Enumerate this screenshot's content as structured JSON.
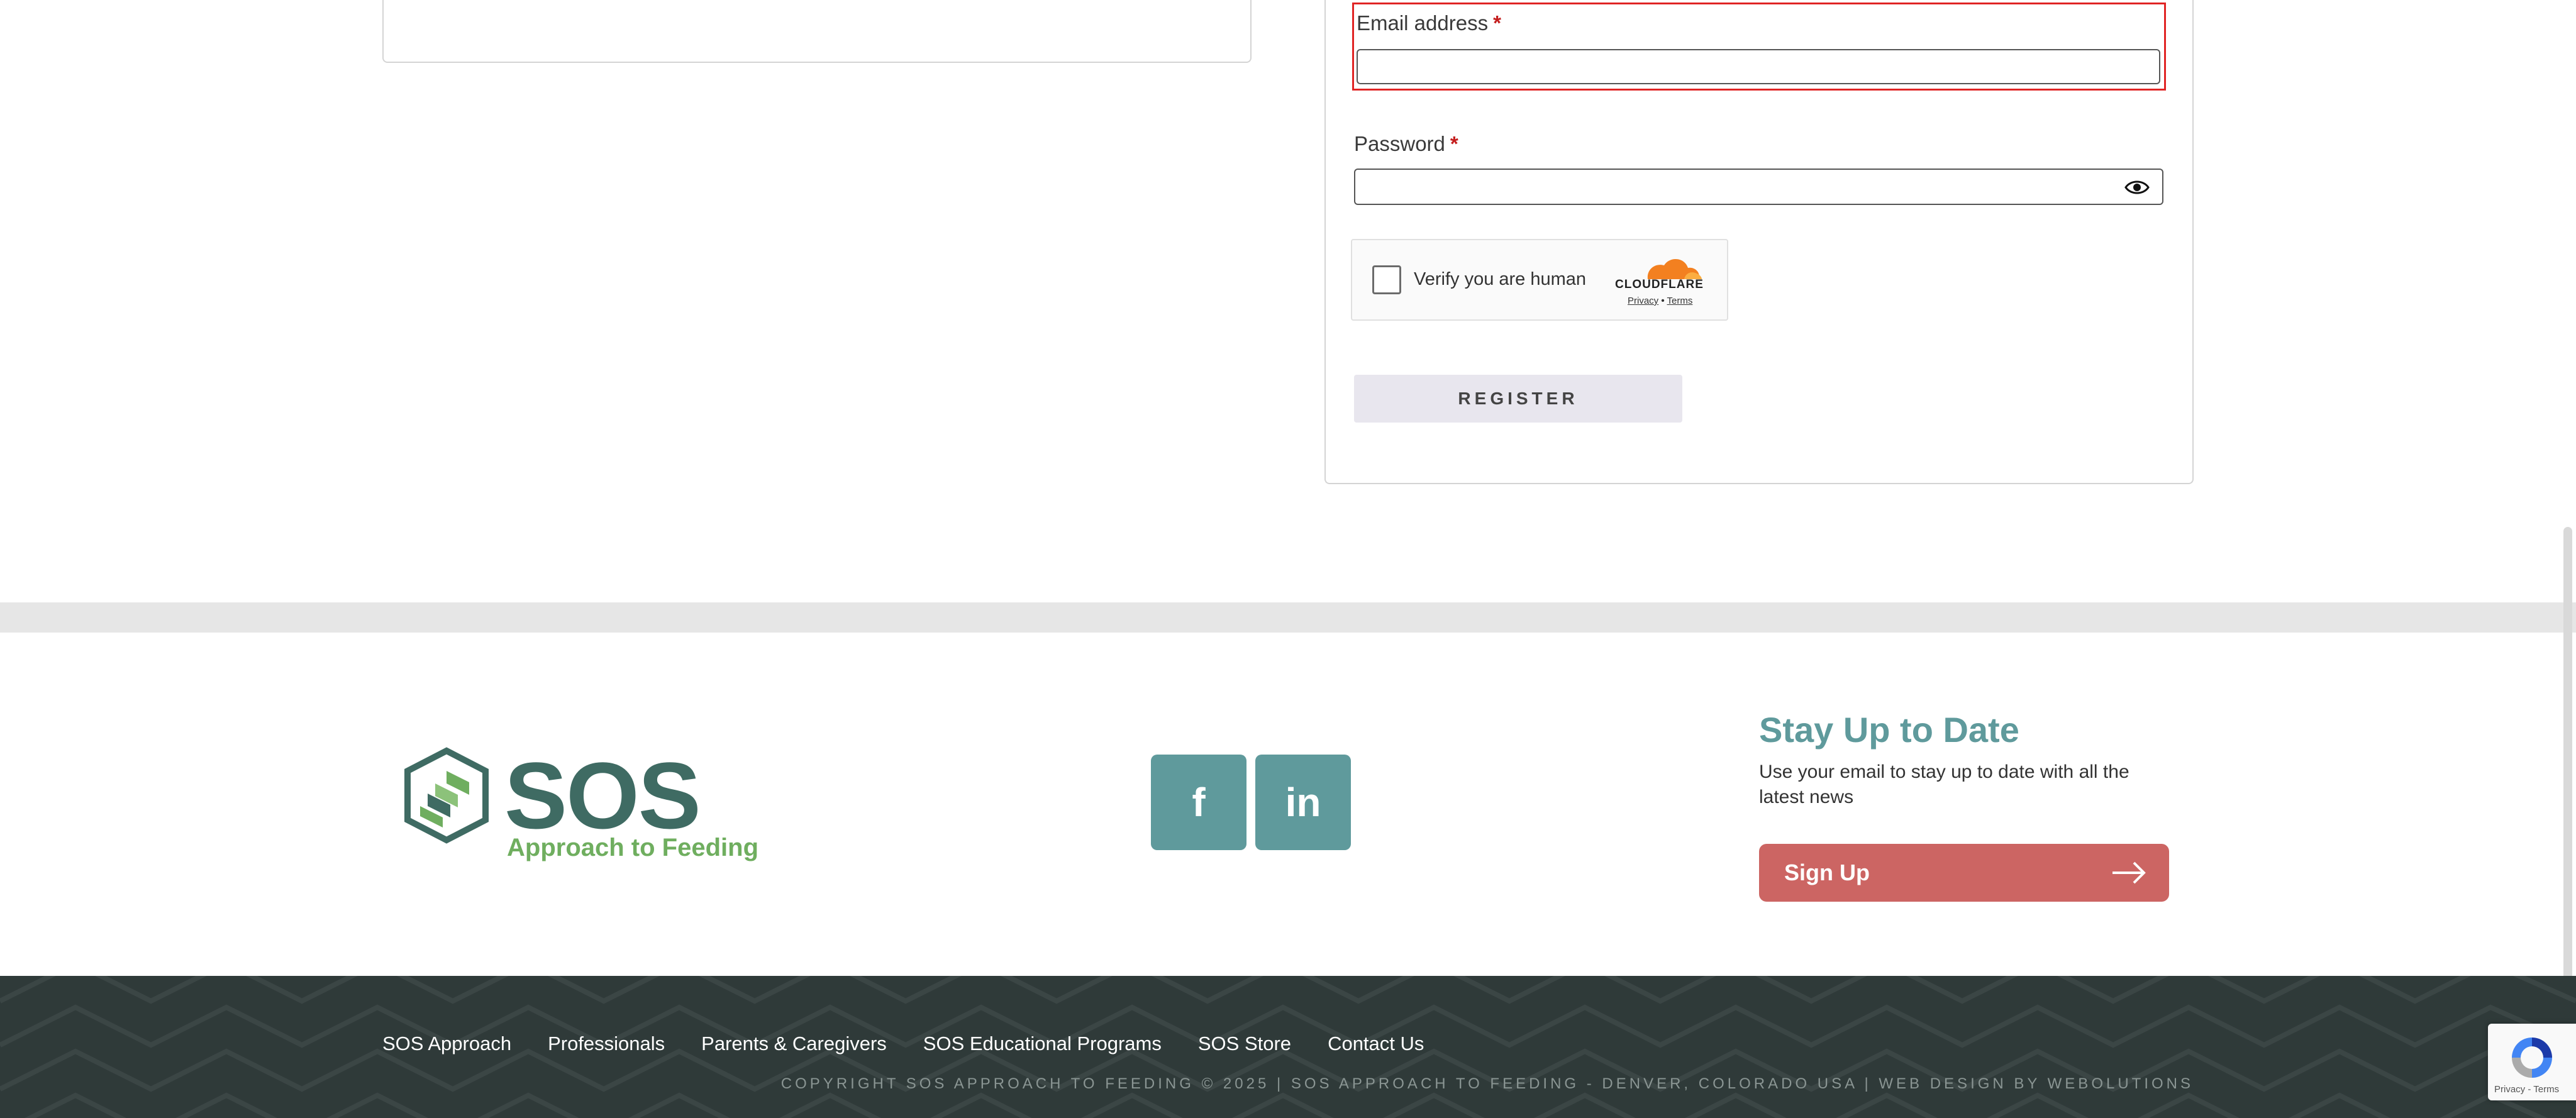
{
  "form": {
    "email_label": "Email address",
    "email_required": "*",
    "email_value": "",
    "password_label": "Password",
    "password_required": "*",
    "password_value": "",
    "register_label": "REGISTER"
  },
  "captcha": {
    "text": "Verify you are human",
    "brand": "CLOUDFLARE",
    "privacy": "Privacy",
    "separator": "•",
    "terms": "Terms"
  },
  "footer": {
    "logo_title": "SOS",
    "logo_reg": "®",
    "logo_subtitle": "Approach to Feeding",
    "social": {
      "facebook": "f",
      "linkedin": "in"
    },
    "newsletter": {
      "title": "Stay Up to Date",
      "description": "Use your email to stay up to date with all the latest news",
      "button_label": "Sign Up"
    },
    "nav": [
      "SOS Approach",
      "Professionals",
      "Parents & Caregivers",
      "SOS Educational Programs",
      "SOS Store",
      "Contact Us"
    ],
    "copyright": "COPYRIGHT SOS APPROACH TO FEEDING © 2025 | SOS APPROACH TO FEEDING - DENVER, COLORADO USA | WEB DESIGN BY WEBOLUTIONS"
  },
  "recaptcha": {
    "links": "Privacy - Terms"
  },
  "colors": {
    "teal": "#5f9a9c",
    "green": "#6fae5f",
    "coral": "#cc6563",
    "dark": "#2f3a39",
    "error": "#e02424"
  }
}
